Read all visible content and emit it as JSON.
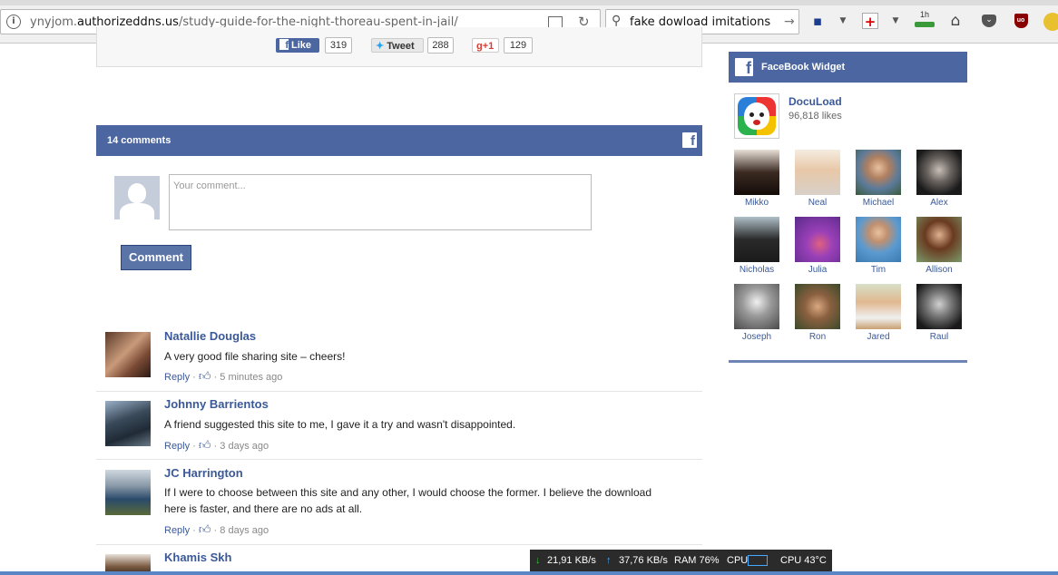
{
  "browser": {
    "url_prefix": "ynyjom.",
    "url_domain": "authorizeddns.us",
    "url_path": "/study-guide-for-the-night-thoreau-spent-in-jail/",
    "search_query": "fake dowload imitations",
    "sync_label": "1h"
  },
  "share": {
    "like_label": "Like",
    "like_count": "319",
    "tweet_label": "Tweet",
    "tweet_count": "288",
    "gplus_label": "g+1",
    "gplus_count": "129"
  },
  "comments_section": {
    "count_label": "14 comments",
    "input_placeholder": "Your comment...",
    "submit_label": "Comment"
  },
  "comments": [
    {
      "name": "Natallie Douglas",
      "text": "A very good file sharing site – cheers!",
      "reply": "Reply",
      "time": "5 minutes ago"
    },
    {
      "name": "Johnny Barrientos",
      "text": "A friend suggested this site to me, I gave it a try and wasn't disappointed.",
      "reply": "Reply",
      "time": "3 days ago"
    },
    {
      "name": "JC Harrington",
      "text": "If I were to choose between this site and any other, I would choose the former. I believe the download here is faster, and there are no ads at all.",
      "reply": "Reply",
      "time": "8 days ago"
    },
    {
      "name": "Khamis Skh"
    }
  ],
  "widget": {
    "title": "FaceBook Widget",
    "page_name": "DocuLoad",
    "page_likes": "96,818 likes",
    "fans": [
      "Mikko",
      "Neal",
      "Michael",
      "Alex",
      "Nicholas",
      "Julia",
      "Tim",
      "Allison",
      "Joseph",
      "Ron",
      "Jared",
      "Raul"
    ]
  },
  "netmeter": {
    "down": "21,91 KB/s",
    "up": "37,76 KB/s",
    "ram": "RAM 76%",
    "cpu_label": "CPU",
    "cpu_temp": "CPU 43°C"
  },
  "colors": {
    "facebook_blue": "#4b66a0",
    "link_blue": "#3b5998"
  }
}
